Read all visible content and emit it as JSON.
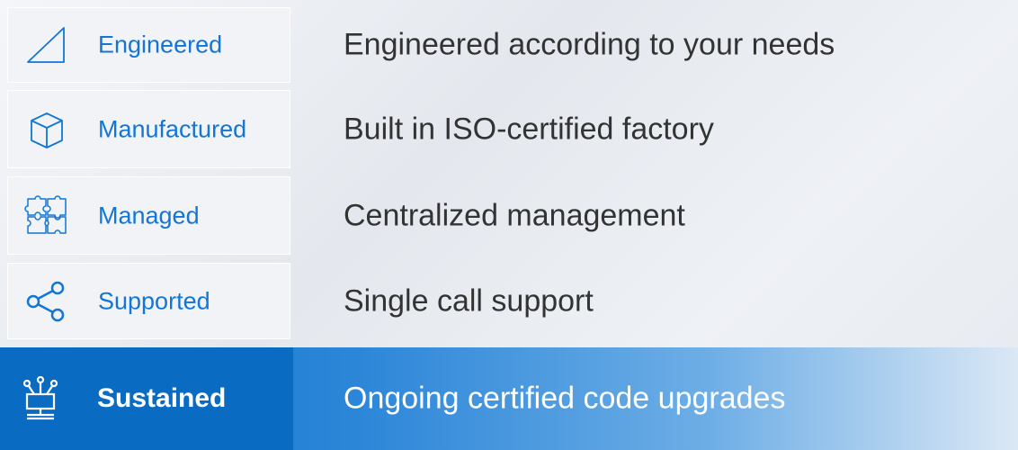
{
  "rows": [
    {
      "label": "Engineered",
      "icon": "triangle-icon",
      "description": "Engineered according to your needs",
      "active": false
    },
    {
      "label": "Manufactured",
      "icon": "box-icon",
      "description": "Built in ISO-certified factory",
      "active": false
    },
    {
      "label": "Managed",
      "icon": "puzzle-icon",
      "description": "Centralized management",
      "active": false
    },
    {
      "label": "Supported",
      "icon": "share-icon",
      "description": "Single call support",
      "active": false
    },
    {
      "label": "Sustained",
      "icon": "network-monitor-icon",
      "description": "Ongoing certified code upgrades",
      "active": true
    }
  ],
  "colors": {
    "accent": "#1176d6",
    "active_bg": "#0a6bc2",
    "text": "#333333"
  }
}
